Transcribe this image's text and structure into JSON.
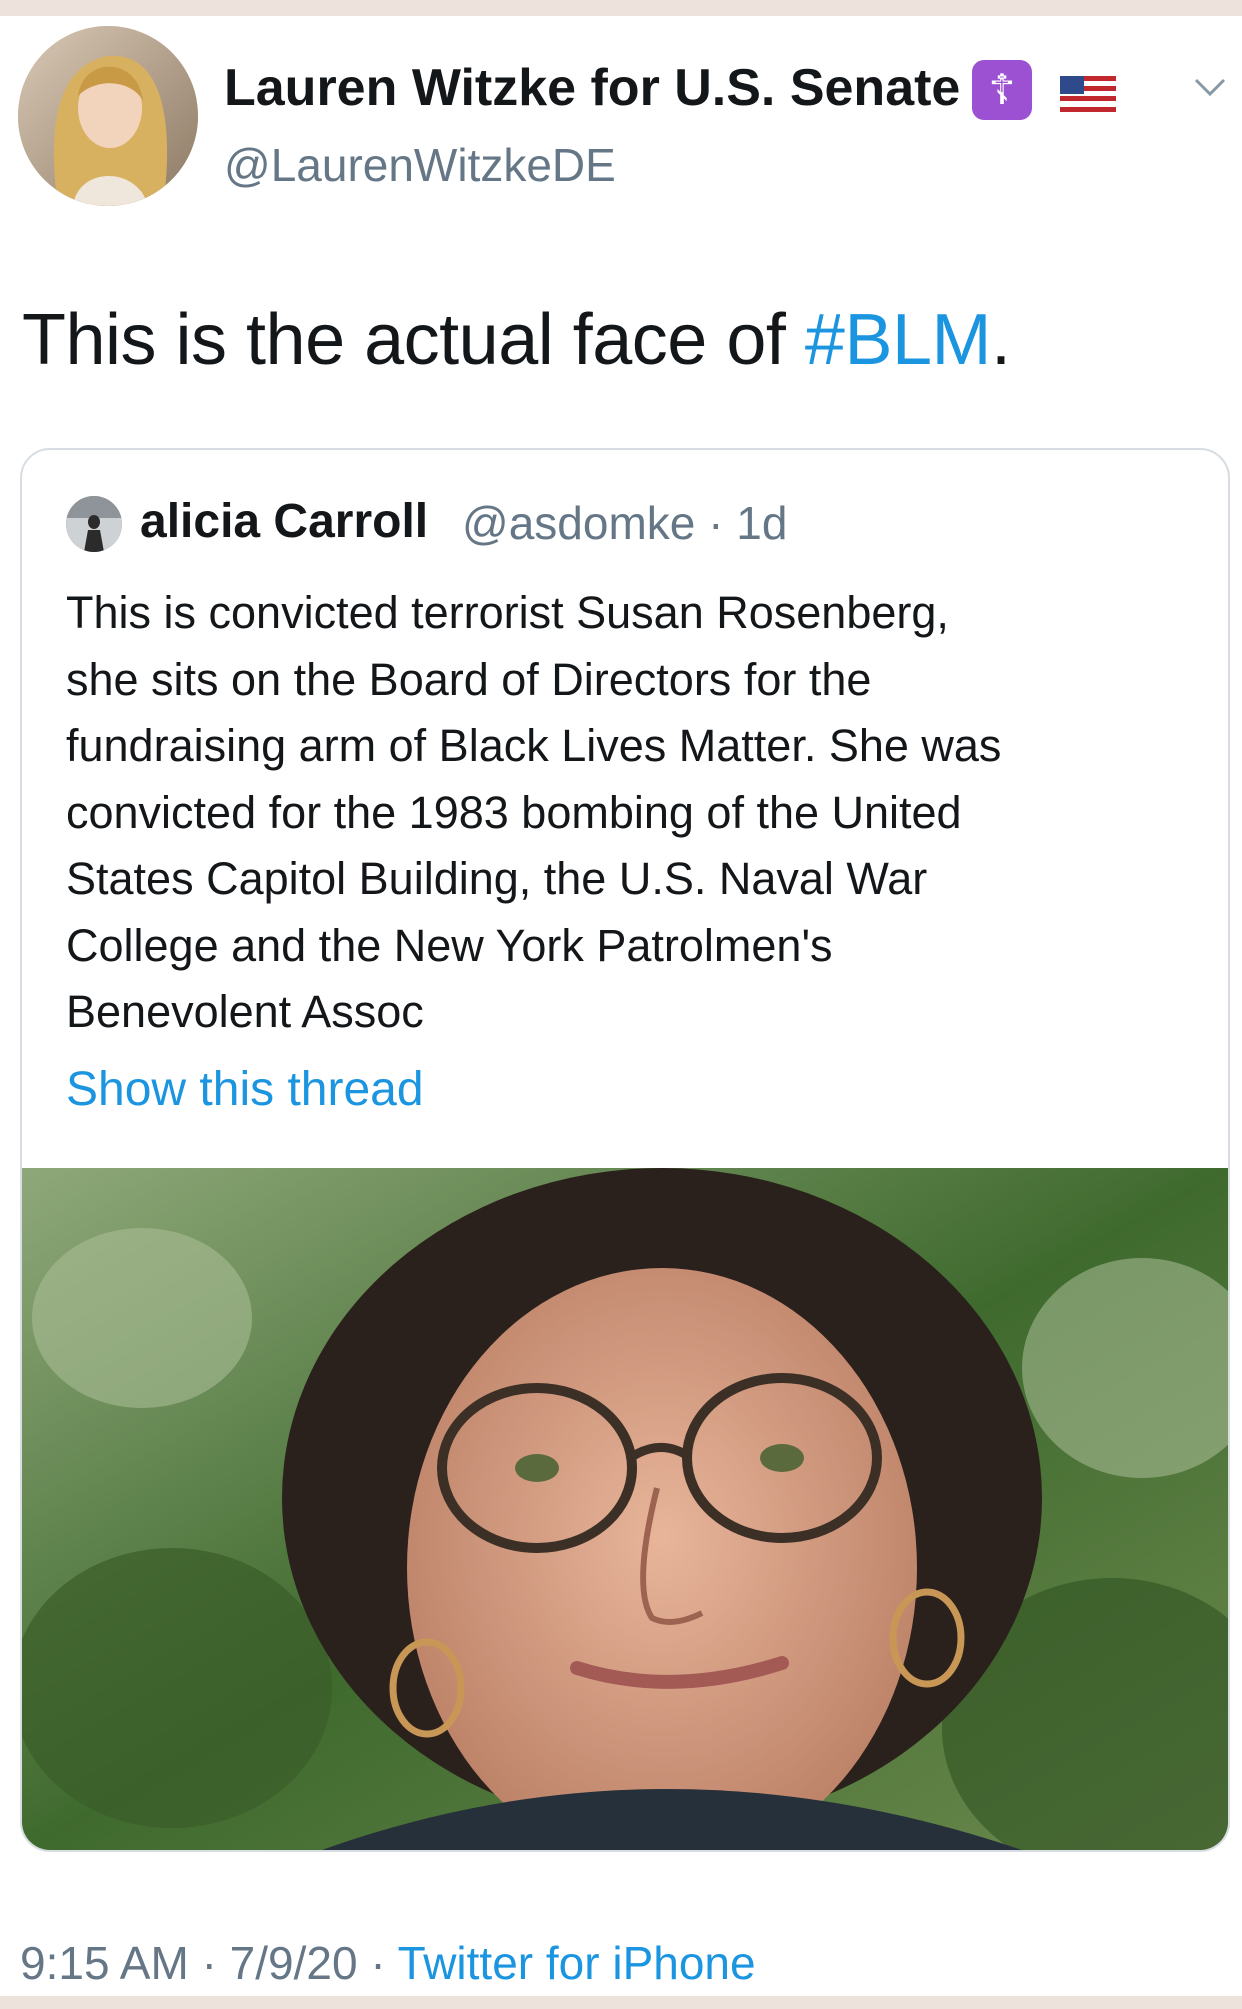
{
  "tweet": {
    "display_name": "Lauren Witzke for U.S. Senate",
    "handle": "@LaurenWitzkeDE",
    "badge_icon": "orthodox-cross-icon",
    "flag_icon": "us-flag-icon",
    "text_prefix": "This is the actual face of ",
    "hashtag": "#BLM",
    "text_suffix": ".",
    "time": "9:15 AM",
    "date": "7/9/20",
    "separator": "·",
    "source": "Twitter for iPhone"
  },
  "quoted_tweet": {
    "name": "alicia Carroll",
    "handle": "@asdomke",
    "separator": "·",
    "age": "1d",
    "lines": [
      "This is convicted terrorist Susan Rosenberg,",
      "she sits on the Board of Directors for the",
      "fundraising arm of Black Lives Matter.  She was",
      "convicted for the 1983 bombing of the United",
      "States Capitol Building, the U.S. Naval War",
      "College and the New York Patrolmen's",
      "Benevolent Assoc"
    ],
    "show_thread": "Show this thread"
  },
  "colors": {
    "link": "#1b95e0",
    "secondary_text": "#657786",
    "primary_text": "#14171a",
    "badge": "#9b51d1"
  }
}
